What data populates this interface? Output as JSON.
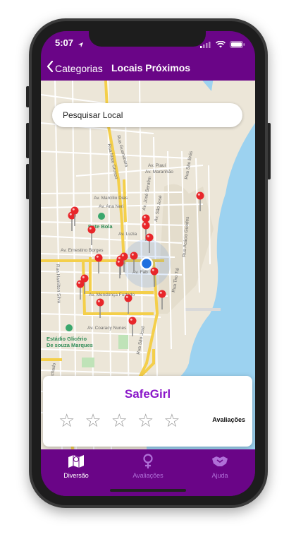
{
  "status": {
    "time": "5:07"
  },
  "nav": {
    "back_label": "Categorias",
    "title": "Locais Próximos"
  },
  "search": {
    "placeholder": "Pesquisar Local",
    "value": ""
  },
  "map": {
    "streets": [
      "Rua Guanabara",
      "Rua Mato Grosso",
      "Av. Piauí",
      "Av. Maranhão",
      "Av. Marcílio Dias",
      "Av. Ana Neri",
      "Av. José Serafim",
      "Av. São José",
      "Av. Luzia",
      "Av. Ernestino Borges",
      "Av. Fab",
      "Rua Hamilton Silva",
      "Av. Mendonça Furtado",
      "Rua Tiro Tiê",
      "Rua Acácio Guedes",
      "Rua São Brás",
      "Av. Coaracy Nunes",
      "Rua Machado",
      "Rua São José"
    ],
    "places": [
      "Bate Bola",
      "Estádio Glicério De souza Marques"
    ],
    "pin_count": 19
  },
  "card": {
    "title": "SafeGirl",
    "rating_label": "Avaliações",
    "stars": 5
  },
  "tabs": [
    {
      "label": "Diversão",
      "icon": "map-icon",
      "active": true
    },
    {
      "label": "Avaliações",
      "icon": "female-icon",
      "active": false
    },
    {
      "label": "Ajuda",
      "icon": "handshake-icon",
      "active": false
    }
  ],
  "colors": {
    "brand": "#6a0587",
    "title": "#8a16c9",
    "pin": "#e8262a",
    "location": "#1d6fe0"
  }
}
